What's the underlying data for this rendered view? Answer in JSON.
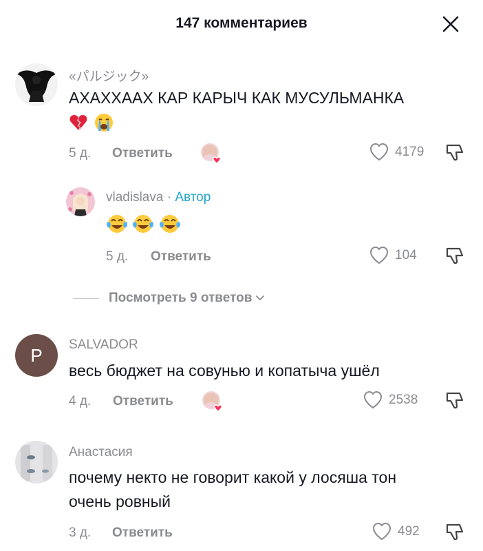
{
  "header": {
    "title": "147 комментариев"
  },
  "comments": [
    {
      "username": "«パルジック»",
      "text_line1": "АХАХХААХ КАР КАРЫЧ КАК МУСУЛЬМАНКА",
      "emojis": [
        "broken-heart",
        "loudly-crying-face"
      ],
      "age": "5 д.",
      "reply_label": "Ответить",
      "likes": "4179"
    },
    {
      "username": "vladislava",
      "separator": " · ",
      "author_badge": "Автор",
      "emojis": [
        "face-with-tears-of-joy",
        "face-with-tears-of-joy",
        "face-with-tears-of-joy"
      ],
      "age": "5 д.",
      "reply_label": "Ответить",
      "likes": "104"
    },
    {
      "avatar_letter": "P",
      "username": "SALVADOR",
      "text_line1": "весь бюджет на совунью и копатыча ушёл",
      "age": "4 д.",
      "reply_label": "Ответить",
      "likes": "2538"
    },
    {
      "username": "Анастасия",
      "text_line1": "почему некто не говорит какой у лосяша тон",
      "text_line2": "очень ровный",
      "age": "3 д.",
      "reply_label": "Ответить",
      "likes": "492"
    }
  ],
  "view_replies": {
    "label": "Посмотреть 9 ответов"
  },
  "colors": {
    "author_accent": "#1fa7c9",
    "like_heart": "#fe2c55",
    "muted_text": "#8a8b91",
    "avatar_brown": "#6b4e48"
  },
  "icons": [
    "close-icon",
    "heart-outline-icon",
    "dislike-icon",
    "chevron-down-icon",
    "creator-liked-badge"
  ]
}
